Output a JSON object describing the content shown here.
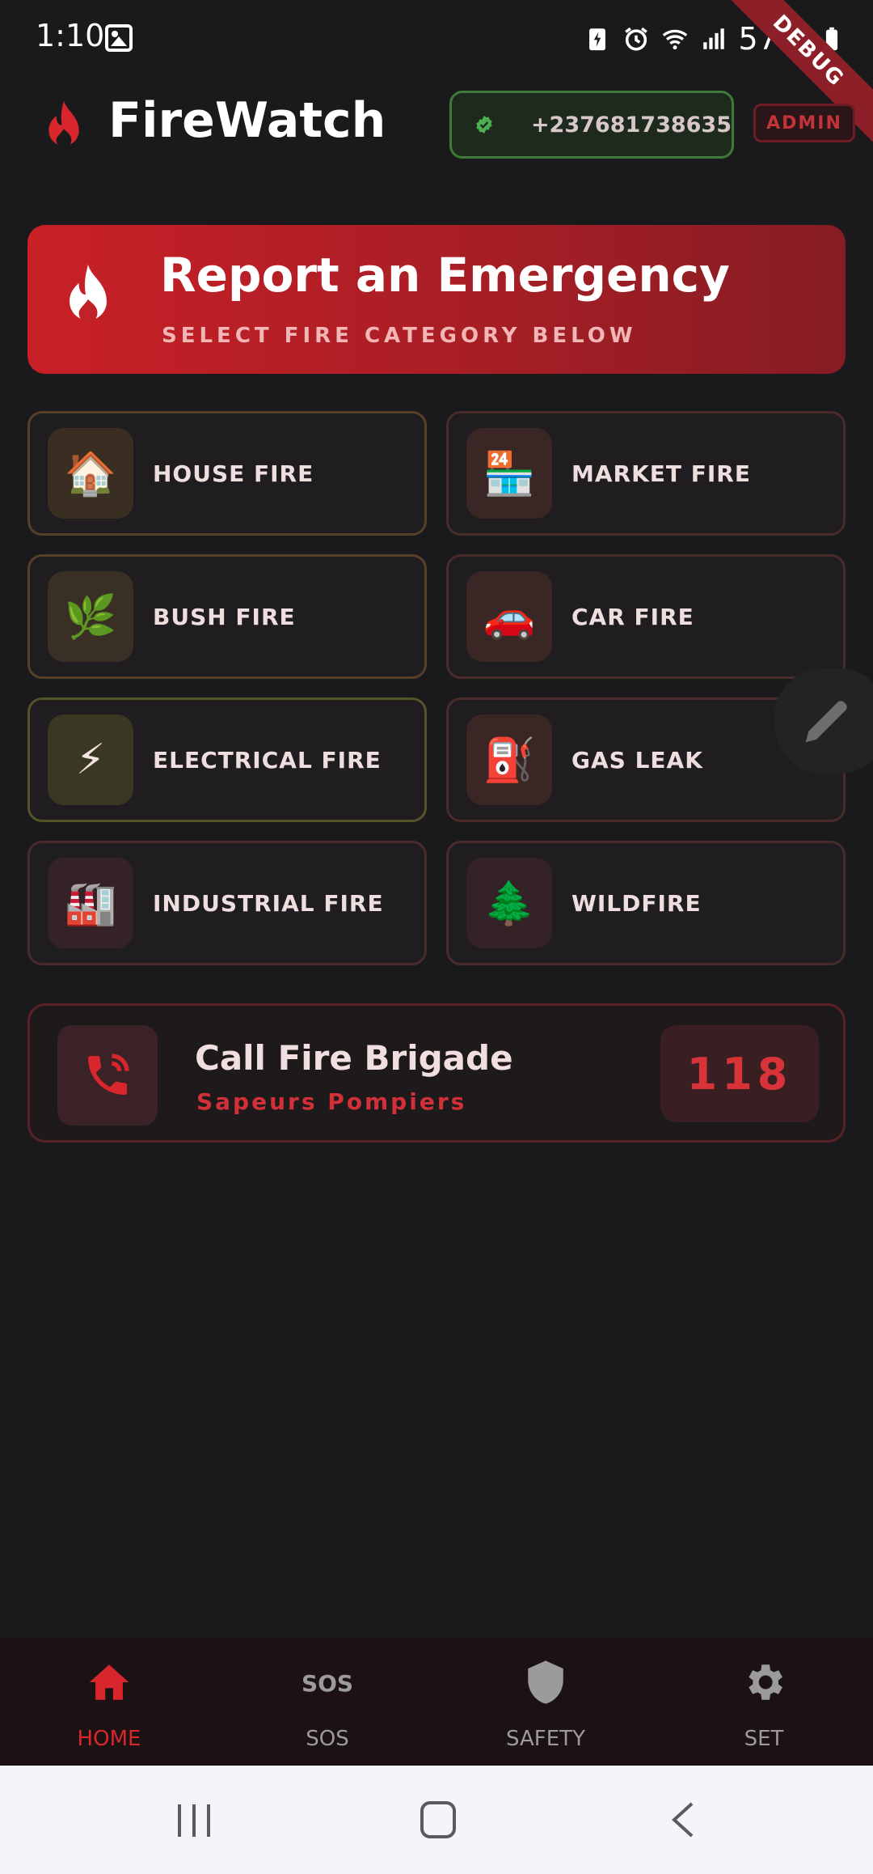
{
  "status_bar": {
    "time": "1:10",
    "battery": "57%",
    "icons": [
      "gallery-icon",
      "battery-saver-icon",
      "alarm-icon",
      "wifi-icon",
      "signal-icon",
      "battery-icon"
    ]
  },
  "debug_ribbon": "DEBUG",
  "header": {
    "title": "FireWatch ...",
    "phone": "+237681738635",
    "role_badge": "ADMIN",
    "logo_icon": "flame-icon",
    "verified_icon": "verified-check-icon"
  },
  "banner": {
    "title": "Report an Emergency",
    "subtitle": "SELECT FIRE CATEGORY BELOW",
    "icon": "flame-icon"
  },
  "categories": [
    {
      "label": "HOUSE FIRE",
      "emoji": "🏠"
    },
    {
      "label": "MARKET FIRE",
      "emoji": "🏪"
    },
    {
      "label": "BUSH FIRE",
      "emoji": "🌿"
    },
    {
      "label": "CAR FIRE",
      "emoji": "🚗"
    },
    {
      "label": "ELECTRICAL FIRE",
      "emoji": "⚡"
    },
    {
      "label": "GAS LEAK",
      "emoji": "⛽"
    },
    {
      "label": "INDUSTRIAL FIRE",
      "emoji": "🏭"
    },
    {
      "label": "WILDFIRE",
      "emoji": "🌲"
    }
  ],
  "call_card": {
    "title": "Call Fire Brigade",
    "subtitle": "Sapeurs Pompiers",
    "number": "118"
  },
  "bottom_nav": [
    {
      "label": "HOME",
      "icon": "home-icon",
      "active": true
    },
    {
      "label": "SOS",
      "icon": "sos-icon",
      "active": false
    },
    {
      "label": "SAFETY",
      "icon": "shield-icon",
      "active": false
    },
    {
      "label": "SET",
      "icon": "gear-icon",
      "active": false
    }
  ],
  "colors": {
    "accent": "#d9262d",
    "background": "#1a1a1c",
    "verified": "#4caf50"
  }
}
